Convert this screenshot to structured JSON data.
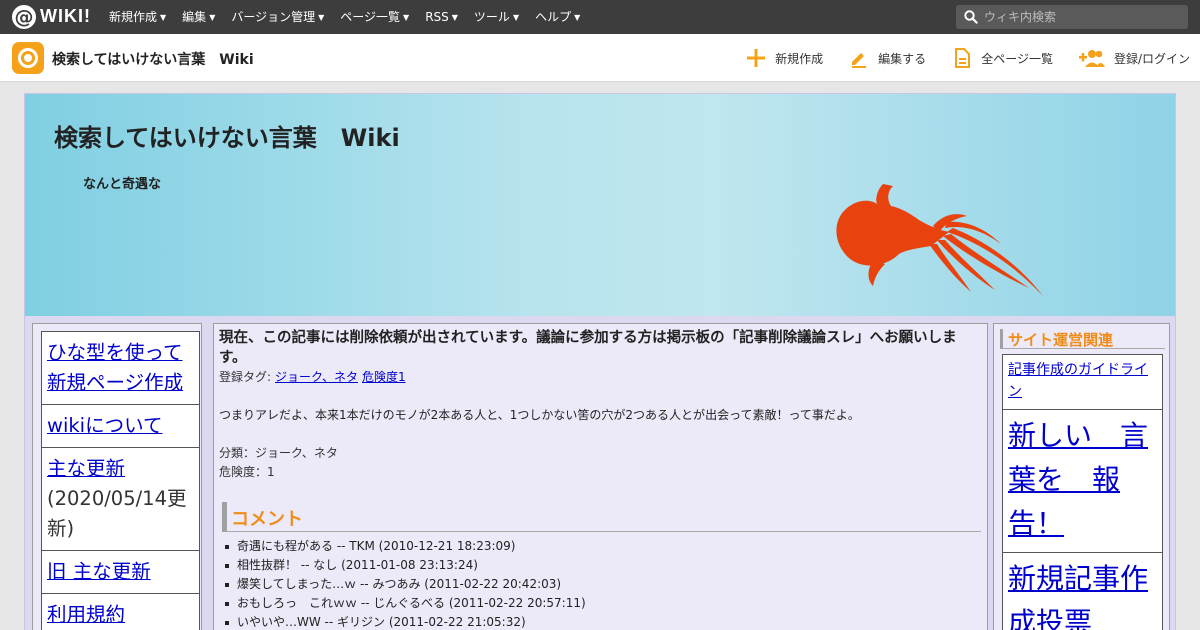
{
  "topbar": {
    "logo_at": "@",
    "logo_text": "WIKI!",
    "nav": [
      "新規作成",
      "編集",
      "バージョン管理",
      "ページ一覧",
      "RSS",
      "ツール",
      "ヘルプ"
    ],
    "search_placeholder": "ウィキ内検索"
  },
  "header": {
    "site_name": "検索してはいけない言葉　Wiki",
    "actions": {
      "new": "新規作成",
      "edit": "編集する",
      "all_pages": "全ページ一覧",
      "login": "登録/ログイン"
    },
    "accent": "#f5a11a"
  },
  "banner": {
    "title": "検索してはいけない言葉　Wiki",
    "subtitle": "なんと奇遇な",
    "fish_color": "#e8420f"
  },
  "left_nav": {
    "items": [
      {
        "label": "ひな型を使って新規ページ作成",
        "note": ""
      },
      {
        "label": "wikiについて",
        "note": ""
      },
      {
        "label": "主な更新",
        "note": "(2020/05/14更新)"
      },
      {
        "label": "旧 主な更新",
        "note": ""
      },
      {
        "label": "利用規約",
        "note": ""
      }
    ]
  },
  "main": {
    "notice": "現在、この記事には削除依頼が出されています。議論に参加する方は掲示板の「記事削除議論スレ」へお願いします。",
    "tags_label": "登録タグ:",
    "tags": [
      "ジョーク、ネタ",
      "危険度1"
    ],
    "body": "つまりアレだよ、本来1本だけのモノが2本ある人と、1つしかない筈の穴が2つある人とが出会って素敵！って事だよ。",
    "classification": "分類：ジョーク、ネタ",
    "danger": "危険度：1",
    "comments_heading": "コメント",
    "comments": [
      "奇遇にも程がある -- TKM (2010-12-21 18:23:09)",
      "相性抜群！ -- なし (2011-01-08 23:13:24)",
      "爆笑してしまった…ｗ -- みつあみ (2011-02-22 20:42:03)",
      "おもしろっ　これｗｗ -- じんぐるべる (2011-02-22 20:57:11)",
      "いやいや…WW -- ギリジン (2011-02-22 21:05:32)"
    ]
  },
  "right_nav": {
    "heading": "サイト運営関連",
    "items": [
      {
        "label": "記事作成のガイドライン",
        "size": "small"
      },
      {
        "label": "新しい　言葉を　報告！",
        "size": "big"
      },
      {
        "label": "新規記事作成投票",
        "size": "big"
      }
    ]
  }
}
